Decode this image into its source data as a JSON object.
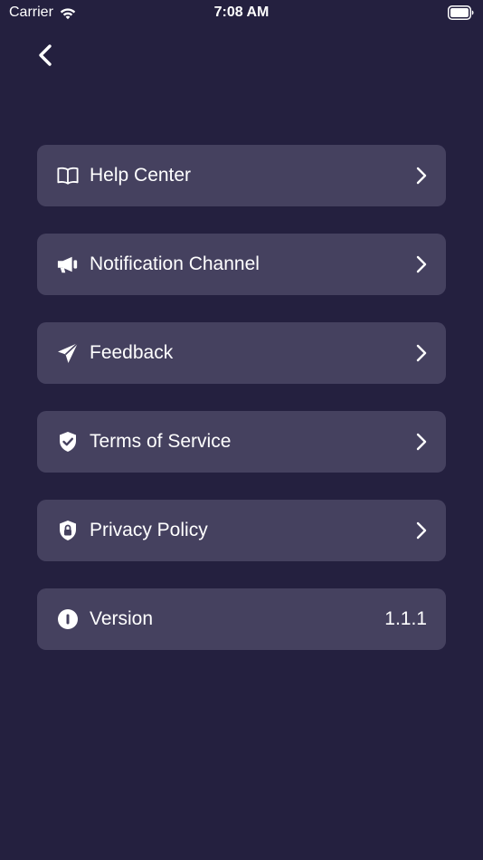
{
  "status_bar": {
    "carrier": "Carrier",
    "time": "7:08 AM"
  },
  "nav": {
    "back_icon": "chevron-left-icon"
  },
  "menu": {
    "items": [
      {
        "label": "Help Center",
        "icon": "book-icon"
      },
      {
        "label": "Notification Channel",
        "icon": "megaphone-icon"
      },
      {
        "label": "Feedback",
        "icon": "paper-plane-icon"
      },
      {
        "label": "Terms of Service",
        "icon": "shield-check-icon"
      },
      {
        "label": "Privacy Policy",
        "icon": "shield-lock-icon"
      }
    ],
    "version": {
      "label": "Version",
      "value": "1.1.1",
      "icon": "info-icon"
    }
  },
  "colors": {
    "background": "#24203f",
    "row_background": "#45415f",
    "text": "#ffffff"
  }
}
